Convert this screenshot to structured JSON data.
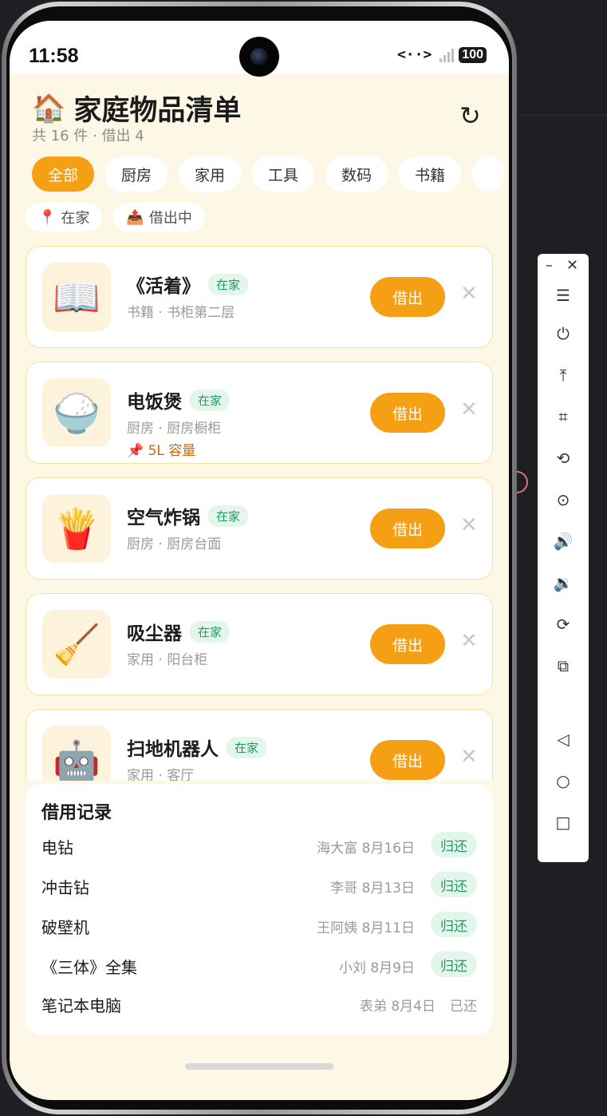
{
  "status_bar": {
    "time": "11:58",
    "nfc": "<··>",
    "battery": "100"
  },
  "header": {
    "icon": "🏠",
    "title": "家庭物品清单",
    "summary": "共 16 件 · 借出 4",
    "refresh_glyph": "↻"
  },
  "categories": [
    "全部",
    "厨房",
    "家用",
    "工具",
    "数码",
    "书籍"
  ],
  "status_filters": [
    {
      "icon": "📍",
      "label": "在家"
    },
    {
      "icon": "📤",
      "label": "借出中"
    }
  ],
  "items": [
    {
      "emoji": "📖",
      "name": "《活着》",
      "badge": "在家",
      "meta": "书籍 · 书柜第二层",
      "note": "",
      "lend": "借出",
      "close": "✕"
    },
    {
      "emoji": "🍚",
      "name": "电饭煲",
      "badge": "在家",
      "meta": "厨房 · 厨房橱柜",
      "note": "📌 5L 容量",
      "lend": "借出",
      "close": "✕"
    },
    {
      "emoji": "🍟",
      "name": "空气炸锅",
      "badge": "在家",
      "meta": "厨房 · 厨房台面",
      "note": "",
      "lend": "借出",
      "close": "✕"
    },
    {
      "emoji": "🧹",
      "name": "吸尘器",
      "badge": "在家",
      "meta": "家用 · 阳台柜",
      "note": "",
      "lend": "借出",
      "close": "✕"
    },
    {
      "emoji": "🤖",
      "name": "扫地机器人",
      "badge": "在家",
      "meta": "家用 · 客厅",
      "note": "",
      "lend": "借出",
      "close": "✕"
    }
  ],
  "records": {
    "title": "借用记录",
    "rows": [
      {
        "name": "电钻",
        "who": "海大富 8月16日",
        "action": "归还",
        "returned": false
      },
      {
        "name": "冲击钻",
        "who": "李哥 8月13日",
        "action": "归还",
        "returned": false
      },
      {
        "name": "破壁机",
        "who": "王阿姨 8月11日",
        "action": "归还",
        "returned": false
      },
      {
        "name": "《三体》全集",
        "who": "小刘 8月9日",
        "action": "归还",
        "returned": false
      },
      {
        "name": "笔记本电脑",
        "who": "表弟 8月4日",
        "action": "已还",
        "returned": true
      }
    ]
  },
  "toolbar": {
    "minimize": "–",
    "close": "✕",
    "buttons": [
      {
        "name": "menu-icon",
        "glyph": "☰"
      },
      {
        "name": "power-icon",
        "glyph": "⏻"
      },
      {
        "name": "upload-icon",
        "glyph": "⤒"
      },
      {
        "name": "crop-icon",
        "glyph": "⌗"
      },
      {
        "name": "rotate-icon",
        "glyph": "⟲"
      },
      {
        "name": "screenshot-icon",
        "glyph": "⊙"
      },
      {
        "name": "volume-up-icon",
        "glyph": "🔊"
      },
      {
        "name": "volume-down-icon",
        "glyph": "🔉"
      },
      {
        "name": "shake-icon",
        "glyph": "⟳"
      },
      {
        "name": "multi-device-icon",
        "glyph": "⧉"
      },
      {
        "name": "back-icon",
        "glyph": "◁"
      },
      {
        "name": "home-icon",
        "glyph": "○"
      },
      {
        "name": "recents-icon",
        "glyph": "□"
      }
    ]
  },
  "colors": {
    "accent": "#f49f14",
    "badge_green": "#1f9a66",
    "badge_bg": "#e3f6ec",
    "screen_bg": "#fdf8e6"
  }
}
